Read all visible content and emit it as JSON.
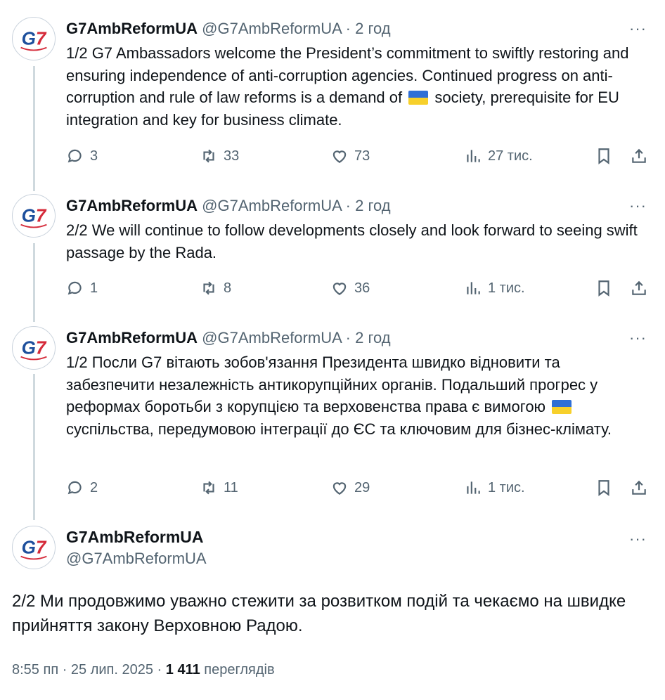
{
  "tweets": [
    {
      "name": "G7AmbReformUA",
      "handle": "@G7AmbReformUA",
      "dot": "·",
      "time": "2 год",
      "text_before_flag": "1/2 G7 Ambassadors welcome the President’s commitment to swiftly restoring and ensuring independence of anti-corruption agencies. Continued progress on anti-corruption and rule of law reforms is a demand of",
      "text_after_flag": "society, prerequisite for EU integration and key for business climate.",
      "replies": "3",
      "reposts": "33",
      "likes": "73",
      "views": "27 тис."
    },
    {
      "name": "G7AmbReformUA",
      "handle": "@G7AmbReformUA",
      "dot": "·",
      "time": "2 год",
      "text_before_flag": "2/2 We will continue to follow developments closely and look forward to seeing swift passage by the Rada.",
      "text_after_flag": "",
      "replies": "1",
      "reposts": "8",
      "likes": "36",
      "views": "1 тис."
    },
    {
      "name": "G7AmbReformUA",
      "handle": "@G7AmbReformUA",
      "dot": "·",
      "time": "2 год",
      "text_before_flag": "1/2 Посли G7 вітають зобов'язання Президента швидко відновити та забезпечити незалежність антикорупційних органів. Подальший прогрес у реформах боротьби з корупцією та верховенства права є вимогою",
      "text_after_flag": "суспільства, передумовою інтеграції до ЄС та ключовим для бізнес-клімату.",
      "replies": "2",
      "reposts": "11",
      "likes": "29",
      "views": "1 тис."
    }
  ],
  "main": {
    "name": "G7AmbReformUA",
    "handle": "@G7AmbReformUA",
    "text": "2/2 Ми продовжимо уважно стежити за розвитком подій та чекаємо на швидке прийняття закону Верховною Радою.",
    "timestamp": "8:55 пп · 25 лип. 2025 · ",
    "views_count": "1 411",
    "views_label": " переглядів"
  },
  "more_glyph": "···",
  "icons": {
    "avatar": "g7-logo-icon",
    "reply": "reply-icon",
    "repost": "repost-icon",
    "like": "heart-icon",
    "views": "views-chart-icon",
    "bookmark": "bookmark-icon",
    "share": "share-icon",
    "more": "more-options-icon",
    "flag": "ukraine-flag-icon"
  },
  "colors": {
    "text": "#0f1419",
    "secondary": "#536471",
    "thread_line": "#cfd9de",
    "logo_blue": "#1d4f9c",
    "logo_red": "#d52b3a"
  }
}
